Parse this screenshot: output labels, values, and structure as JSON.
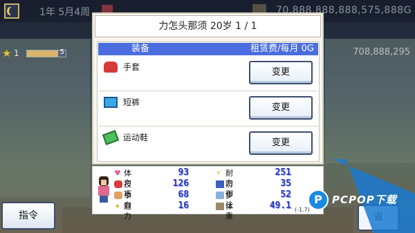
{
  "hud": {
    "date": "1年 5月4周",
    "money": "70,888,888,888,575,888G",
    "rank": "1",
    "exp_progress": 0.8,
    "exp_label": "5",
    "funds": "708,888,295"
  },
  "dialog": {
    "title": "力怎头那须 20岁 1 / 1",
    "header_equip": "装备",
    "header_rent": "租赁费/每月 0G",
    "items": [
      {
        "label": "手套",
        "button": "变更",
        "icon": "glove-icon"
      },
      {
        "label": "短裤",
        "button": "变更",
        "icon": "shorts-icon"
      },
      {
        "label": "运动鞋",
        "button": "变更",
        "icon": "shoes-icon"
      }
    ]
  },
  "stats": {
    "hp_label": "体力",
    "hp_value": "93",
    "tech_label": "技巧",
    "tech_value": "126",
    "punch_label": "拳力",
    "punch_value": "68",
    "charm_label": "魅力",
    "charm_value": "16",
    "stamina_label": "耐力",
    "stamina_value": "251",
    "defense_label": "防御",
    "defense_value": "35",
    "footwork_label": "步法",
    "footwork_value": "52",
    "weight_label": "体重",
    "weight_value": "49.1",
    "weight_delta": "(-1.7)"
  },
  "buttons": {
    "command": "指令",
    "back": "返"
  },
  "watermark": {
    "logo": "P",
    "text": "PCPOP下载"
  },
  "colors": {
    "header_blue": "#4a6ee0",
    "stat_value_blue": "#2a3bbf",
    "watermark_blue": "#1a8ae0"
  }
}
